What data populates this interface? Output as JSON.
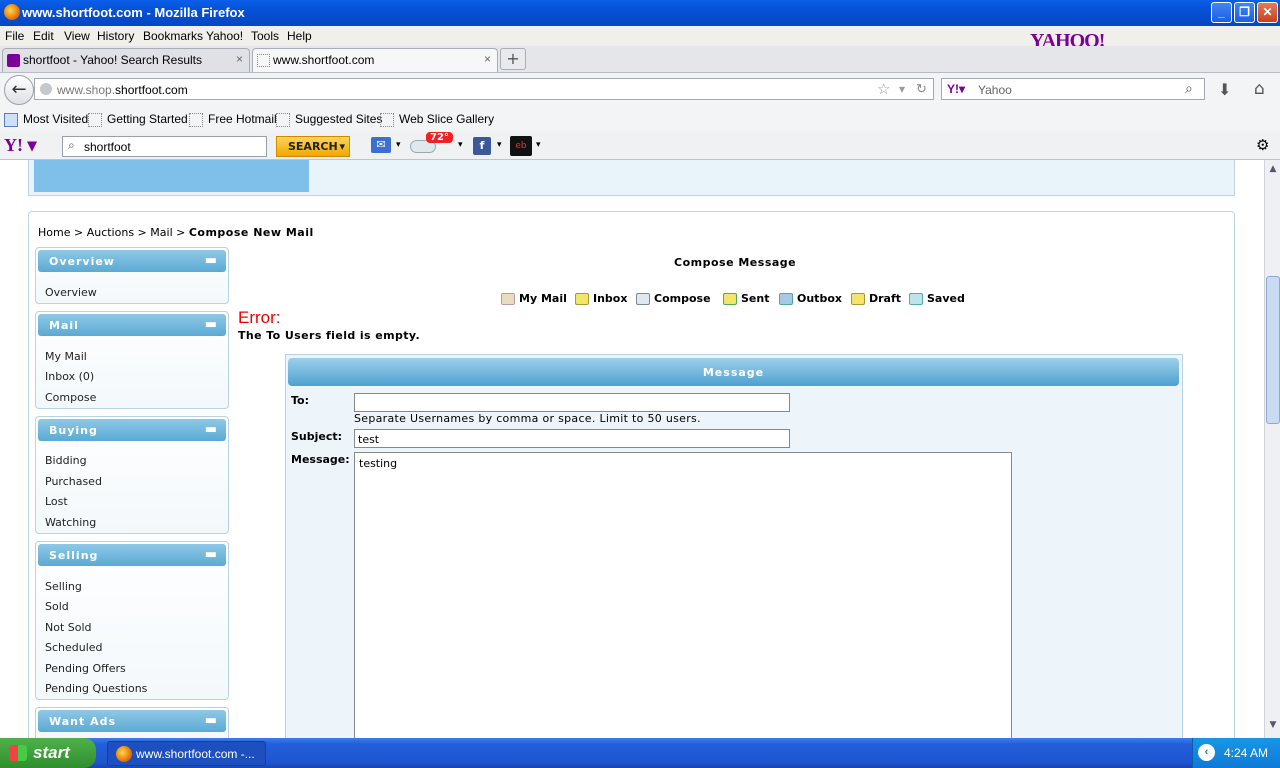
{
  "window": {
    "title": "www.shortfoot.com - Mozilla Firefox"
  },
  "menu": [
    "File",
    "Edit",
    "View",
    "History",
    "Bookmarks",
    "Yahoo!",
    "Tools",
    "Help"
  ],
  "brand": {
    "logo": "YAHOO!"
  },
  "tabs": [
    {
      "label": "shortfoot - Yahoo! Search Results"
    },
    {
      "label": "www.shortfoot.com"
    }
  ],
  "nav": {
    "url_prefix": "www.shop.",
    "url_domain": "shortfoot.com",
    "search_placeholder": "Yahoo"
  },
  "bookmarks": [
    "Most Visited",
    "Getting Started",
    "Free Hotmail",
    "Suggested Sites",
    "Web Slice Gallery"
  ],
  "yahoo_toolbar": {
    "search_value": "shortfoot",
    "search_button": "SEARCH",
    "weather": "72°"
  },
  "breadcrumb": {
    "home": "Home",
    "auctions": "Auctions",
    "mail": "Mail",
    "current": "Compose New Mail"
  },
  "sidebar": {
    "overview": {
      "title": "Overview",
      "items": [
        "Overview"
      ]
    },
    "mail": {
      "title": "Mail",
      "items": [
        "My Mail",
        "Inbox (0)",
        "Compose"
      ]
    },
    "buying": {
      "title": "Buying",
      "items": [
        "Bidding",
        "Purchased",
        "Lost",
        "Watching"
      ]
    },
    "selling": {
      "title": "Selling",
      "items": [
        "Selling",
        "Sold",
        "Not Sold",
        "Scheduled",
        "Pending Offers",
        "Pending Questions"
      ]
    },
    "wantads": {
      "title": "Want Ads"
    }
  },
  "compose": {
    "title": "Compose Message",
    "nav": [
      "My Mail",
      "Inbox",
      "Compose",
      "Sent",
      "Outbox",
      "Draft",
      "Saved"
    ],
    "error_title": "Error:",
    "error_message": "The To Users field is empty.",
    "panel_title": "Message",
    "to_label": "To:",
    "to_value": "",
    "hint": "Separate Usernames by comma or space. Limit to 50 users.",
    "subject_label": "Subject:",
    "subject_value": "test",
    "message_label": "Message:",
    "message_value": "testing"
  },
  "taskbar": {
    "start": "start",
    "task": "www.shortfoot.com -...",
    "clock": "4:24 AM"
  }
}
